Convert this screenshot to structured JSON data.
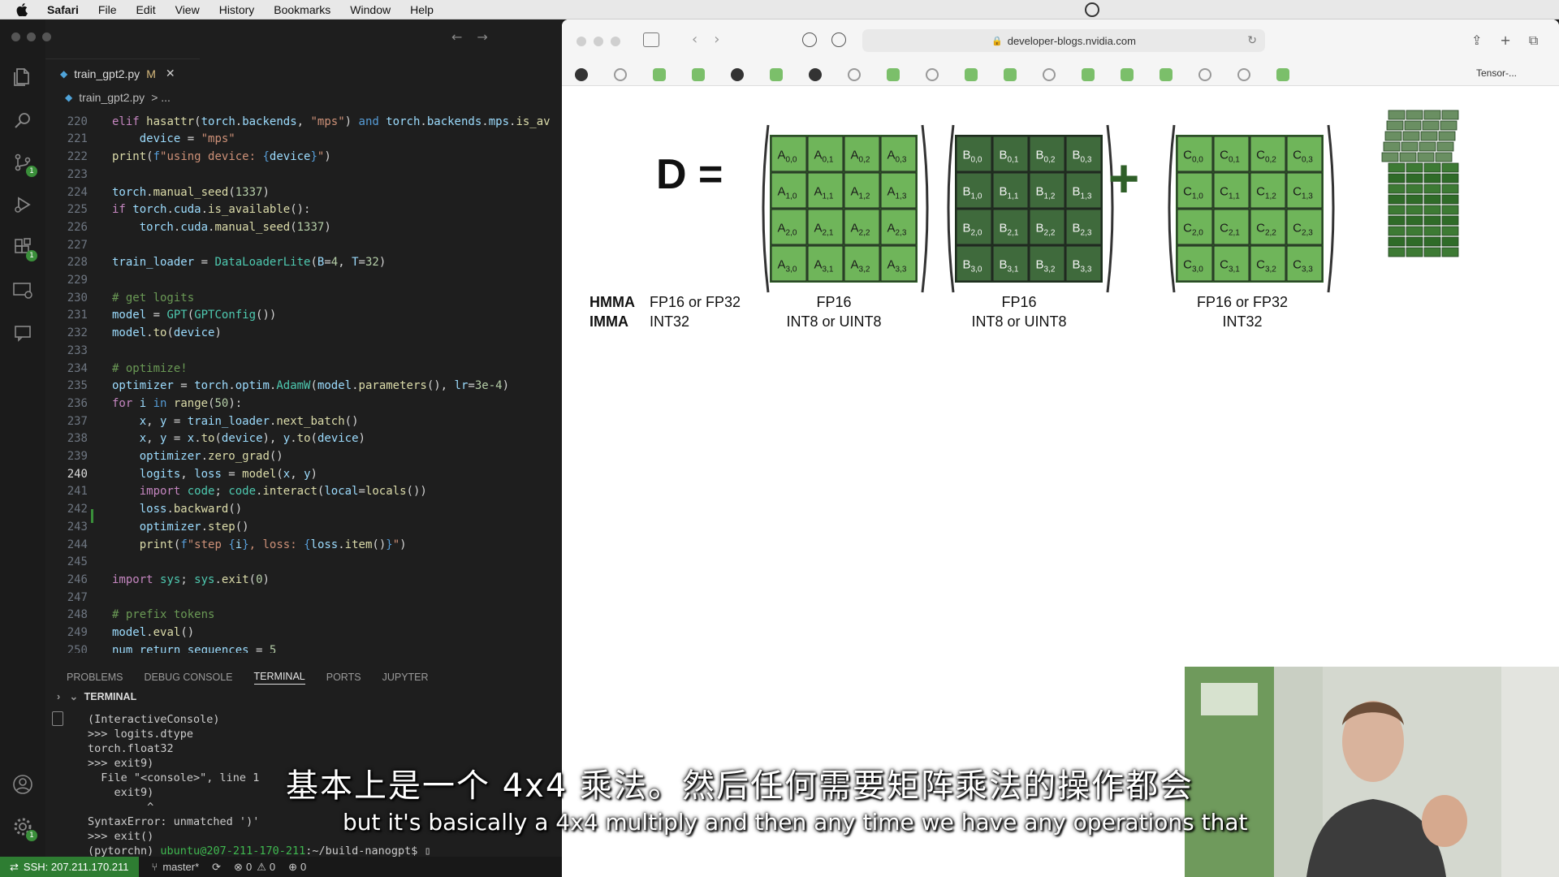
{
  "menubar": {
    "app": "Safari",
    "items": [
      "File",
      "Edit",
      "View",
      "History",
      "Bookmarks",
      "Window",
      "Help"
    ]
  },
  "vscode": {
    "tab": {
      "filename": "train_gpt2.py",
      "modified": "M"
    },
    "breadcrumb": {
      "file": "train_gpt2.py",
      "rest": "> ..."
    },
    "panel_tabs": [
      "PROBLEMS",
      "DEBUG CONSOLE",
      "TERMINAL",
      "PORTS",
      "JUPYTER"
    ],
    "active_panel_tab": "TERMINAL",
    "terminal_header": "TERMINAL",
    "terminal_lines": [
      "(InteractiveConsole)",
      ">>> logits.dtype",
      "torch.float32",
      ">>> exit9)",
      "  File \"<console>\", line 1",
      "    exit9)",
      "         ^",
      "SyntaxError: unmatched ')'",
      ">>> exit()"
    ],
    "prompt": {
      "env": "(pytorchn)",
      "user_host": "ubuntu@207-211-170-211",
      "path": ":~/build-nanogpt$"
    },
    "status": {
      "ssh": "SSH: 207.211.170.211",
      "branch": "master*",
      "problems": "0",
      "warnings": "0",
      "ports": "0"
    },
    "current_line": 240
  },
  "safari": {
    "url": "developer-blogs.nvidia.com",
    "last_tab": "Tensor-..."
  },
  "figure": {
    "lhs": "D =",
    "plus": "+",
    "labels": {
      "hmma": "HMMA",
      "imma": "IMMA",
      "d_hmma": "FP16 or FP32",
      "d_imma": "INT32",
      "a_hmma": "FP16",
      "a_imma": "INT8 or UINT8",
      "b_hmma": "FP16",
      "b_imma": "INT8 or UINT8",
      "c_hmma": "FP16 or FP32",
      "c_imma": "INT32"
    },
    "matrices": [
      {
        "name": "A",
        "color": "#6fb55a",
        "border": "#2f5f28"
      },
      {
        "name": "B",
        "color": "#3f6a3c",
        "border": "#1c331c"
      },
      {
        "name": "C",
        "color": "#6fb55a",
        "border": "#2f5f28"
      }
    ]
  },
  "captions": {
    "zh": "基本上是一个 4x4 乘法。然后任何需要矩阵乘法的操作都会",
    "en": "but it's basically a 4x4 multiply and then any time we have any operations that"
  }
}
